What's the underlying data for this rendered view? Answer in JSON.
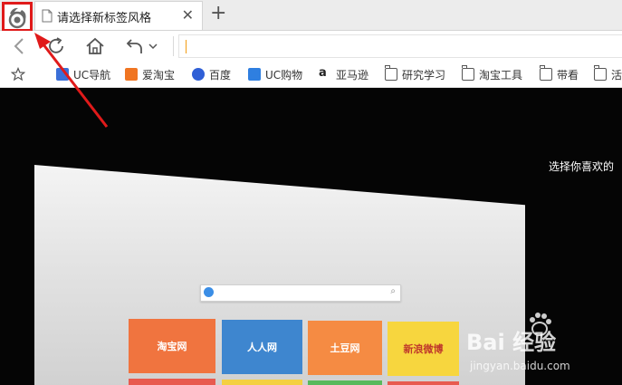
{
  "browser": {
    "tab": {
      "title": "请选择新标签风格",
      "close_glyph": "✕"
    },
    "new_tab_glyph": "+",
    "logo_icon": "uc-squirrel-logo-icon",
    "nav_icons": [
      "back-arrow-icon",
      "refresh-icon",
      "home-icon",
      "undo-icon",
      "chevron-down-icon",
      "star-icon"
    ],
    "address_bar": {
      "value": ""
    }
  },
  "bookmarks": [
    {
      "label": "UC导航",
      "icon": "uc-nav-icon",
      "color": "#3a6fd8"
    },
    {
      "label": "爱淘宝",
      "icon": "taobao-icon",
      "color": "#f07522"
    },
    {
      "label": "百度",
      "icon": "baidu-paw-icon",
      "color": "#2f5fd6"
    },
    {
      "label": "UC购物",
      "icon": "uc-shop-icon",
      "color": "#2f7fe0"
    },
    {
      "label": "亚马逊",
      "icon": "amazon-icon",
      "color": "#222222"
    },
    {
      "label": "研究学习",
      "icon": "folder-icon",
      "color": "#555555"
    },
    {
      "label": "淘宝工具",
      "icon": "folder-icon",
      "color": "#555555"
    },
    {
      "label": "带看",
      "icon": "folder-icon",
      "color": "#555555"
    },
    {
      "label": "活",
      "icon": "folder-icon",
      "color": "#555555"
    }
  ],
  "content": {
    "caption": "选择你喜欢的",
    "preview_tiles": [
      {
        "label": "淘宝网",
        "color": "#f0743f"
      },
      {
        "label": "人人网",
        "color": "#3e86cf"
      },
      {
        "label": "土豆网",
        "color": "#f58b43"
      },
      {
        "label": "新浪微博",
        "color": "#f7d63e"
      }
    ],
    "tile_row2_colors": [
      "#e85a4f",
      "#f4d042",
      "#58b95c",
      "#e85a4f"
    ]
  },
  "watermark": {
    "brand": "Bai 经验",
    "url": "jingyan.baidu.com"
  },
  "annotation": {
    "color": "#e01a1a",
    "note_icon": "red-arrow-annotation"
  }
}
